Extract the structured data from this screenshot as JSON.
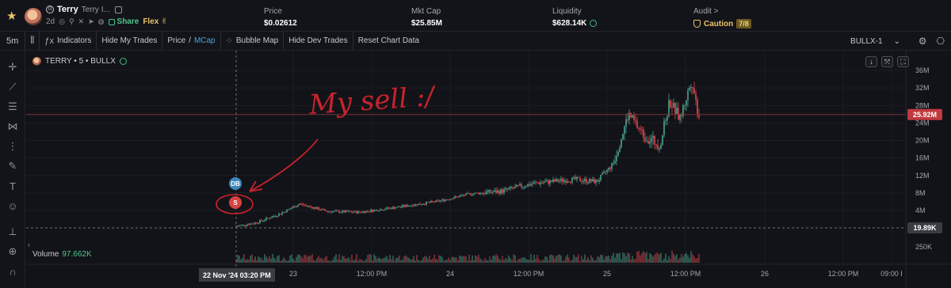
{
  "header": {
    "ticker": "Terry",
    "full_name": "Terry I...",
    "age": "2d",
    "share_label": "Share",
    "flex_label": "Flex",
    "stats": [
      {
        "label": "Price",
        "value": "$0.02612"
      },
      {
        "label": "Mkt Cap",
        "value": "$25.85M"
      },
      {
        "label": "Liquidity",
        "value": "$628.14K"
      },
      {
        "label": "Audit >",
        "value": "Caution",
        "badge": "7/8"
      }
    ]
  },
  "toolbar": {
    "timeframe": "5m",
    "indicators": "Indicators",
    "hide_my_trades": "Hide My Trades",
    "price": "Price",
    "slash": "/",
    "mcap": "MCap",
    "bubble_map": "Bubble Map",
    "hide_dev_trades": "Hide Dev Trades",
    "reset_chart": "Reset Chart Data",
    "symbol": "BULLX-1"
  },
  "chart": {
    "legend": "TERRY • 5 • BULLX",
    "volume_label": "Volume",
    "volume_value": "97.662K",
    "price_axis": [
      "36M",
      "32M",
      "28M",
      "24M",
      "20M",
      "16M",
      "12M",
      "8M",
      "4M",
      "250K"
    ],
    "current_price_tag": "25.92M",
    "cursor_price_tag": "19.89K",
    "time_axis": [
      "23",
      "12:00 PM",
      "24",
      "12:00 PM",
      "25",
      "12:00 PM",
      "26",
      "12:00 PM",
      "09:00 I"
    ],
    "cursor_date": "22 Nov '24   03:20 PM",
    "marker_db": "DB",
    "marker_s": "S",
    "annotation": "My sell :/"
  },
  "colors": {
    "up": "#4aa68f",
    "down": "#e0494f",
    "annotation": "#c8232c",
    "accent_blue": "#4aa3df"
  }
}
